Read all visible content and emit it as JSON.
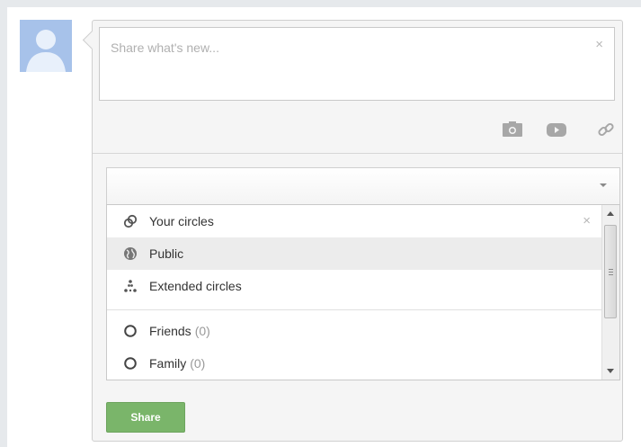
{
  "avatar": {
    "icon": "default-profile-silhouette-icon",
    "bg": "#a7c2ea"
  },
  "compose": {
    "placeholder": "Share what's new...",
    "close_glyph": "×"
  },
  "media_icons": [
    "camera-icon",
    "video-play-icon",
    "link-chain-icon"
  ],
  "audience": {
    "value": "",
    "menu_items": [
      {
        "icon": "circles-icon",
        "label": "Your circles",
        "close_glyph": "×"
      },
      {
        "icon": "globe-icon",
        "label": "Public",
        "highlighted": true
      },
      {
        "icon": "extended-circles-icon",
        "label": "Extended circles"
      },
      {
        "icon": "circle-outline-icon",
        "label": "Friends",
        "count": "(0)"
      },
      {
        "icon": "circle-outline-icon",
        "label": "Family",
        "count": "(0)"
      }
    ]
  },
  "share_button": {
    "label": "Share",
    "color": "#7ab56a"
  }
}
